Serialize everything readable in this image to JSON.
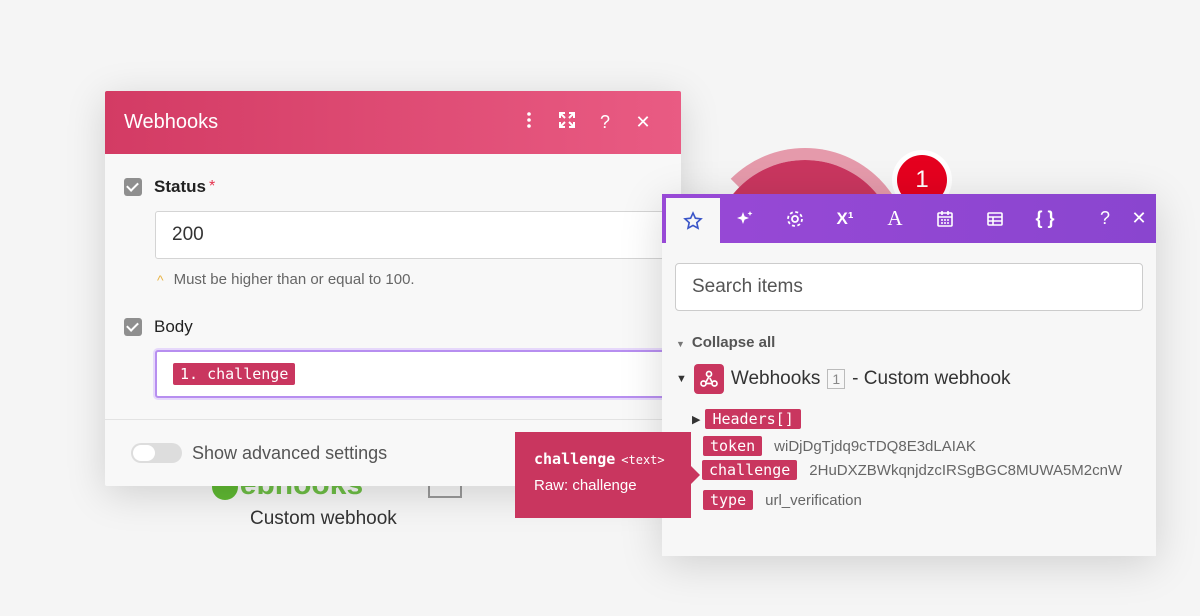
{
  "background": {
    "module_badge": "1",
    "node_title": "Webhooks",
    "node_subtitle": "Custom webhook"
  },
  "dialog": {
    "title": "Webhooks",
    "fields": {
      "status": {
        "label": "Status",
        "required_mark": "*",
        "value": "200",
        "hint": "Must be higher than or equal to 100."
      },
      "body": {
        "label": "Body",
        "pill": "1. challenge"
      }
    },
    "advanced_label": "Show advanced settings"
  },
  "panel": {
    "search_placeholder": "Search items",
    "collapse_all": "Collapse all",
    "module": {
      "name": "Webhooks",
      "number": "1",
      "suffix": "- Custom webhook"
    },
    "items": [
      {
        "key": "Headers[]",
        "value": ""
      },
      {
        "key": "token",
        "value": "wiDjDgTjdq9cTDQ8E3dLAIAK"
      },
      {
        "key": "challenge",
        "value": "2HuDXZBWkqnjdzcIRSgBGC8MUWA5M2cnW"
      },
      {
        "key": "type",
        "value": "url_verification"
      }
    ]
  },
  "tooltip": {
    "name": "challenge",
    "type": "<text>",
    "raw": "Raw: challenge"
  },
  "colors": {
    "brand": "#c9365f",
    "toolbar": "#9849d6",
    "accent": "#3a55c8"
  },
  "icons": [
    "more-vertical-icon",
    "expand-icon",
    "help-icon",
    "close-icon",
    "star-icon",
    "sparkle-icon",
    "gear-icon",
    "superscript-icon",
    "text-icon",
    "calendar-icon",
    "table-icon",
    "braces-icon",
    "webhook-icon"
  ]
}
